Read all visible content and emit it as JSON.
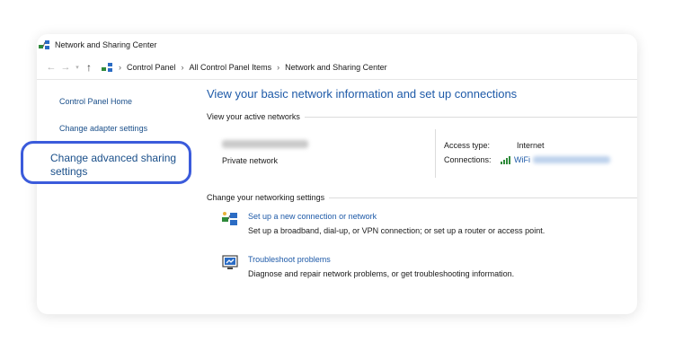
{
  "window": {
    "title": "Network and Sharing Center",
    "icon": "network-icon"
  },
  "address_bar": {
    "back_icon": "back-arrow-icon",
    "forward_icon": "forward-arrow-icon",
    "recent_icon": "chevron-down-icon",
    "up_icon": "up-arrow-icon",
    "path": [
      "Control Panel",
      "All Control Panel Items",
      "Network and Sharing Center"
    ],
    "separator": "›"
  },
  "sidebar": {
    "items": [
      {
        "label": "Control Panel Home"
      },
      {
        "label": "Change adapter settings"
      },
      {
        "label": "Change advanced sharing settings",
        "highlighted": true
      }
    ],
    "highlight_color": "#3b5bdb"
  },
  "main": {
    "title": "View your basic network information and set up connections",
    "active_networks": {
      "heading": "View your active networks",
      "network_type": "Private network",
      "access_type_label": "Access type:",
      "access_type_value": "Internet",
      "connections_label": "Connections:",
      "connections_value": "WiFi"
    },
    "settings": {
      "heading": "Change your networking settings",
      "tasks": [
        {
          "icon": "new-connection-icon",
          "link": "Set up a new connection or network",
          "description": "Set up a broadband, dial-up, or VPN connection; or set up a router or access point."
        },
        {
          "icon": "troubleshoot-icon",
          "link": "Troubleshoot problems",
          "description": "Diagnose and repair network problems, or get troubleshooting information."
        }
      ]
    }
  },
  "colors": {
    "link": "#1e5aa8",
    "title": "#1e5aa8",
    "highlight": "#3b5bdb"
  }
}
